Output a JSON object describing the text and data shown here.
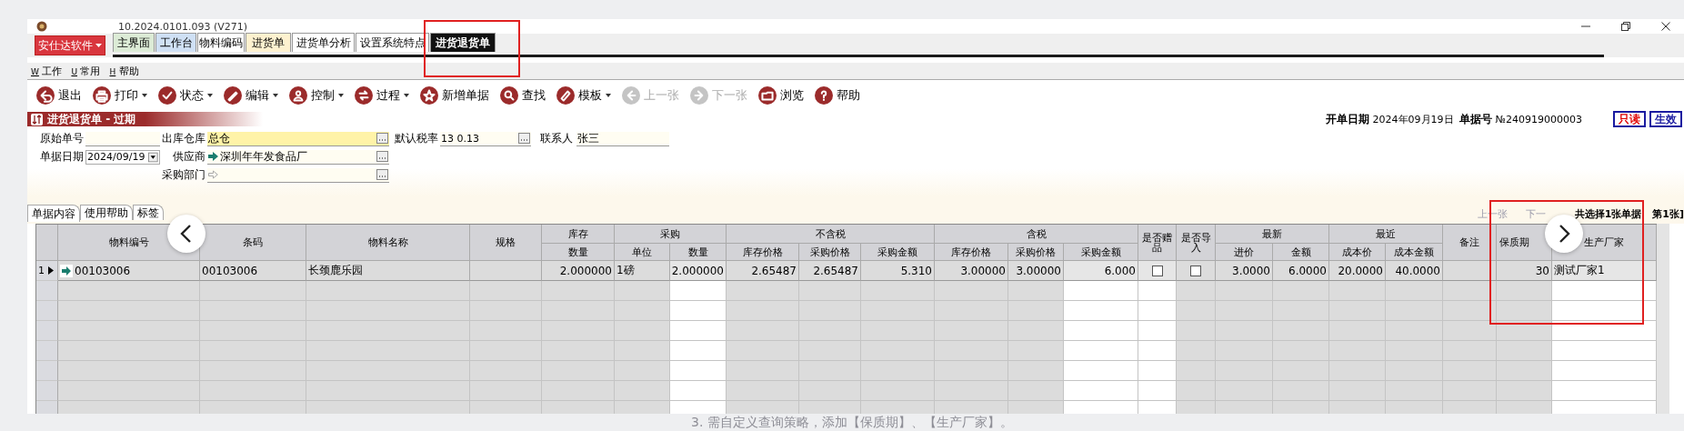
{
  "window": {
    "title": "10.2024.0101.093 (V271)"
  },
  "app_menu": {
    "label": "安仕达软件"
  },
  "tabs": [
    {
      "label": "主界面",
      "selected": false,
      "color": "#dcebd6"
    },
    {
      "label": "工作台",
      "selected": false,
      "color": "#cfe0f4"
    },
    {
      "label": "物料编码",
      "selected": false,
      "color": "#ffffff"
    },
    {
      "label": "进货单",
      "selected": false,
      "color": "#fdf1cf"
    },
    {
      "label": "进货单分析",
      "selected": false,
      "color": "#ffffff"
    },
    {
      "label": "设置系统特点",
      "selected": false,
      "color": "#ffffff"
    },
    {
      "label": "进货退货单",
      "selected": true
    }
  ],
  "menu": [
    {
      "key": "W",
      "label": "工作"
    },
    {
      "key": "U",
      "label": "常用"
    },
    {
      "key": "H",
      "label": "帮助"
    }
  ],
  "toolbar": [
    {
      "label": "退出",
      "dropdown": false,
      "disabled": false
    },
    {
      "label": "打印",
      "dropdown": true,
      "disabled": false
    },
    {
      "label": "状态",
      "dropdown": true,
      "disabled": false
    },
    {
      "label": "编辑",
      "dropdown": true,
      "disabled": false
    },
    {
      "label": "控制",
      "dropdown": true,
      "disabled": false
    },
    {
      "label": "过程",
      "dropdown": true,
      "disabled": false
    },
    {
      "label": "新增单据",
      "dropdown": false,
      "disabled": false
    },
    {
      "label": "查找",
      "dropdown": false,
      "disabled": false
    },
    {
      "label": "模板",
      "dropdown": true,
      "disabled": false
    },
    {
      "label": "上一张",
      "dropdown": false,
      "disabled": true
    },
    {
      "label": "下一张",
      "dropdown": false,
      "disabled": true
    },
    {
      "label": "浏览",
      "dropdown": false,
      "disabled": false
    },
    {
      "label": "帮助",
      "dropdown": false,
      "disabled": false
    }
  ],
  "form": {
    "title": "进货退货单 - 过期",
    "open_date_label": "开单日期",
    "open_date": "2024年09月19日",
    "number_label": "单据号",
    "number": "№240919000003",
    "badges": [
      {
        "label": "只读",
        "color": "#e00000"
      },
      {
        "label": "生效",
        "color": "#1a1aa0"
      }
    ],
    "original_no": {
      "label": "原始单号"
    },
    "warehouse": {
      "label": "出库仓库",
      "value": "总仓"
    },
    "tax_rate": {
      "label": "默认税率",
      "value": "13 0.13"
    },
    "contact": {
      "label": "联系人",
      "value": "张三"
    },
    "date": {
      "label": "单据日期",
      "value": "2024/09/19"
    },
    "supplier": {
      "label": "供应商",
      "value": "深圳年年发食品厂"
    },
    "department": {
      "label": "采购部门"
    }
  },
  "sub_tabs": [
    {
      "label": "单据内容",
      "selected": true
    },
    {
      "label": "使用帮助",
      "selected": false
    },
    {
      "label": "标签",
      "selected": false
    }
  ],
  "pager": {
    "previous": "上一张",
    "next": "下一",
    "summary": "共选择1张单据",
    "current": "第1张]"
  },
  "table": {
    "column_groups": [
      {
        "label": "库存"
      },
      {
        "label": "采购"
      },
      {
        "label": "不含税"
      },
      {
        "label": "含税"
      },
      {
        "label": "最新"
      },
      {
        "label": "最近"
      }
    ],
    "columns": [
      {
        "label": "物料编号",
        "kind": "text",
        "editable": false,
        "group_start": false
      },
      {
        "label": "条码",
        "kind": "text",
        "editable": false,
        "group_start": false
      },
      {
        "label": "物料名称",
        "kind": "text",
        "editable": false,
        "group_start": false
      },
      {
        "label": "规格",
        "kind": "text",
        "editable": false,
        "group_start": false
      },
      {
        "label": "数量",
        "kind": "number",
        "editable": false,
        "group_start": true
      },
      {
        "label": "单位",
        "kind": "text",
        "editable": false,
        "group_start": true
      },
      {
        "label": "数量",
        "kind": "number",
        "editable": true,
        "grouped": true
      },
      {
        "label": "库存价格",
        "kind": "number",
        "editable": false,
        "group_start": true
      },
      {
        "label": "采购价格",
        "kind": "number",
        "editable": false,
        "grouped": true
      },
      {
        "label": "采购金额",
        "kind": "number",
        "editable": false,
        "grouped": true
      },
      {
        "label": "库存价格",
        "kind": "number",
        "editable": false,
        "group_start": true
      },
      {
        "label": "采购价格",
        "kind": "number",
        "editable": false,
        "grouped": true
      },
      {
        "label": "采购金额",
        "kind": "number",
        "editable": true,
        "grouped": true
      },
      {
        "label": "是否赠品",
        "kind": "check",
        "editable": true,
        "group_start": false
      },
      {
        "label": "是否导入",
        "kind": "check",
        "editable": false,
        "group_start": false
      },
      {
        "label": "进价",
        "kind": "number",
        "editable": false,
        "group_start": true
      },
      {
        "label": "金额",
        "kind": "number",
        "editable": false,
        "grouped": true
      },
      {
        "label": "成本价",
        "kind": "number",
        "editable": false,
        "group_start": true
      },
      {
        "label": "成本金额",
        "kind": "number",
        "editable": false,
        "grouped": true
      },
      {
        "label": "备注",
        "kind": "text",
        "editable": false,
        "group_start": false
      },
      {
        "label": "保质期",
        "kind": "number",
        "editable": false,
        "group_start": false
      },
      {
        "label": "生产厂家",
        "kind": "text",
        "editable": true,
        "group_start": false
      }
    ],
    "rows": [
      {
        "number": "1",
        "current": true,
        "cells": [
          "00103006",
          "00103006",
          "长颈鹿乐园",
          null,
          "2.000000",
          "1磅",
          "2.000000",
          "2.65487",
          "2.65487",
          "5.310",
          "3.00000",
          "3.00000",
          "6.000",
          {
            "checked": false
          },
          {
            "checked": false
          },
          "3.0000",
          "6.0000",
          "20.0000",
          "40.0000",
          null,
          "30",
          "测试厂家1"
        ]
      }
    ]
  },
  "footnote": "3.  需自定义查询策略，添加【保质期】、【生产厂家】。"
}
